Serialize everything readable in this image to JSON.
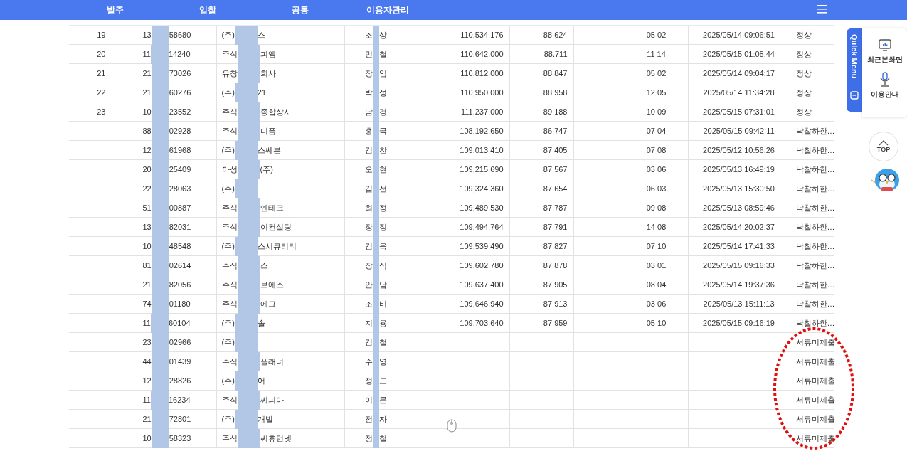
{
  "nav": {
    "items": [
      "발주",
      "입찰",
      "공통",
      "이용자관리"
    ]
  },
  "table": {
    "rows": [
      {
        "rank": "19",
        "biz_no": [
          "13",
          "58680"
        ],
        "company": [
          "(주)",
          "스"
        ],
        "representative": [
          "조",
          "상"
        ],
        "amount": "110,534,176",
        "rate": "88.624",
        "code": "05 02",
        "datetime": "2025/05/14 09:06:51",
        "status": "정상"
      },
      {
        "rank": "20",
        "biz_no": [
          "11",
          "14240"
        ],
        "company": [
          "주식",
          "피엠"
        ],
        "representative": [
          "민",
          "철"
        ],
        "amount": "110,642,000",
        "rate": "88.711",
        "code": "11 14",
        "datetime": "2025/05/15 01:05:44",
        "status": "정상"
      },
      {
        "rank": "21",
        "biz_no": [
          "21",
          "73026"
        ],
        "company": [
          "유창",
          "회사"
        ],
        "representative": [
          "장",
          "임"
        ],
        "amount": "110,812,000",
        "rate": "88.847",
        "code": "05 02",
        "datetime": "2025/05/14 09:04:17",
        "status": "정상"
      },
      {
        "rank": "22",
        "biz_no": [
          "21",
          "60276"
        ],
        "company": [
          "(주)",
          "21"
        ],
        "representative": [
          "박",
          "성"
        ],
        "amount": "110,950,000",
        "rate": "88.958",
        "code": "12 05",
        "datetime": "2025/05/14 11:34:28",
        "status": "정상"
      },
      {
        "rank": "23",
        "biz_no": [
          "10",
          "23552"
        ],
        "company": [
          "주식",
          "종합상사"
        ],
        "representative": [
          "남",
          "경"
        ],
        "amount": "111,237,000",
        "rate": "89.188",
        "code": "10 09",
        "datetime": "2025/05/15 07:31:01",
        "status": "정상"
      },
      {
        "biz_no": [
          "88",
          "02928"
        ],
        "company": [
          "주식",
          "디폼"
        ],
        "representative": [
          "홍",
          "국"
        ],
        "amount": "108,192,650",
        "rate": "86.747",
        "code": "07 04",
        "datetime": "2025/05/15 09:42:11",
        "status": "낙찰하한…"
      },
      {
        "biz_no": [
          "12",
          "61968"
        ],
        "company": [
          "(주)",
          "스쎄븐"
        ],
        "representative": [
          "김",
          "찬"
        ],
        "amount": "109,013,410",
        "rate": "87.405",
        "code": "07 08",
        "datetime": "2025/05/12 10:56:26",
        "status": "낙찰하한…"
      },
      {
        "biz_no": [
          "20",
          "25409"
        ],
        "company": [
          "아성",
          "(주)"
        ],
        "representative": [
          "오",
          "현"
        ],
        "amount": "109,215,690",
        "rate": "87.567",
        "code": "03 06",
        "datetime": "2025/05/13 16:49:19",
        "status": "낙찰하한…"
      },
      {
        "biz_no": [
          "22",
          "28063"
        ],
        "company": [
          "(주)"
        ],
        "representative": [
          "김",
          "선"
        ],
        "amount": "109,324,360",
        "rate": "87.654",
        "code": "06 03",
        "datetime": "2025/05/13 15:30:50",
        "status": "낙찰하한…"
      },
      {
        "biz_no": [
          "51",
          "00887"
        ],
        "company": [
          "주식",
          "엔테크"
        ],
        "representative": [
          "최",
          "정"
        ],
        "amount": "109,489,530",
        "rate": "87.787",
        "code": "09 08",
        "datetime": "2025/05/13 08:59:46",
        "status": "낙찰하한…"
      },
      {
        "biz_no": [
          "13",
          "82031"
        ],
        "company": [
          "주식",
          "이컨설팅"
        ],
        "representative": [
          "장",
          "정"
        ],
        "amount": "109,494,764",
        "rate": "87.791",
        "code": "14 08",
        "datetime": "2025/05/14 20:02:37",
        "status": "낙찰하한…"
      },
      {
        "biz_no": [
          "10",
          "48548"
        ],
        "company": [
          "(주)",
          "스시큐리티"
        ],
        "representative": [
          "김",
          "욱"
        ],
        "amount": "109,539,490",
        "rate": "87.827",
        "code": "07 10",
        "datetime": "2025/05/14 17:41:33",
        "status": "낙찰하한…"
      },
      {
        "biz_no": [
          "81",
          "02614"
        ],
        "company": [
          "주식",
          "스"
        ],
        "representative": [
          "장",
          "식"
        ],
        "amount": "109,602,780",
        "rate": "87.878",
        "code": "03 01",
        "datetime": "2025/05/15 09:16:33",
        "status": "낙찰하한…"
      },
      {
        "biz_no": [
          "21",
          "82056"
        ],
        "company": [
          "주식",
          "브에스"
        ],
        "representative": [
          "안",
          "남"
        ],
        "amount": "109,637,400",
        "rate": "87.905",
        "code": "08 04",
        "datetime": "2025/05/14 19:37:36",
        "status": "낙찰하한…"
      },
      {
        "biz_no": [
          "74",
          "01180"
        ],
        "company": [
          "주식",
          "에그"
        ],
        "representative": [
          "조",
          "비"
        ],
        "amount": "109,646,940",
        "rate": "87.913",
        "code": "03 06",
        "datetime": "2025/05/13 15:11:13",
        "status": "낙찰하한…"
      },
      {
        "biz_no": [
          "11",
          "60104"
        ],
        "company": [
          "(주)",
          "솔"
        ],
        "representative": [
          "지",
          "용"
        ],
        "amount": "109,703,640",
        "rate": "87.959",
        "code": "05 10",
        "datetime": "2025/05/15 09:16:19",
        "status": "낙찰하한…"
      },
      {
        "biz_no": [
          "23",
          "02966"
        ],
        "company": [
          "(주)"
        ],
        "representative": [
          "김",
          "철"
        ],
        "status": "서류미제출"
      },
      {
        "biz_no": [
          "44",
          "01439"
        ],
        "company": [
          "주식",
          "플래너"
        ],
        "representative": [
          "주",
          "영"
        ],
        "status": "서류미제출"
      },
      {
        "biz_no": [
          "12",
          "28826"
        ],
        "company": [
          "(주)",
          "어"
        ],
        "representative": [
          "정",
          "도"
        ],
        "status": "서류미제출"
      },
      {
        "biz_no": [
          "11",
          "16234"
        ],
        "company": [
          "주식",
          "씨피아"
        ],
        "representative": [
          "이",
          "문"
        ],
        "status": "서류미제출"
      },
      {
        "biz_no": [
          "21",
          "72801"
        ],
        "company": [
          "(주)",
          "개발"
        ],
        "representative": [
          "전",
          "자"
        ],
        "status": "서류미제출"
      },
      {
        "biz_no": [
          "10",
          "58323"
        ],
        "company": [
          "주식",
          "씨휴먼넷"
        ],
        "representative": [
          "정",
          "철"
        ],
        "status": "서류미제출"
      }
    ]
  },
  "quick_menu": {
    "title": "Quick Menu",
    "items": [
      {
        "kind": "recent",
        "label": "최근본화면"
      },
      {
        "kind": "guide",
        "label": "이용안내"
      }
    ],
    "top_label": "TOP"
  }
}
